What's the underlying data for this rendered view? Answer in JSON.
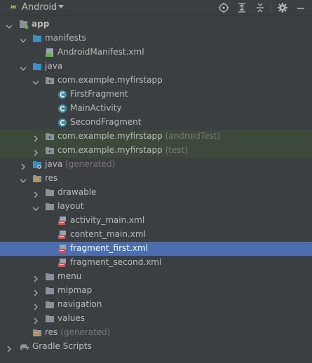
{
  "toolbar": {
    "view_name": "Android",
    "colors": {
      "android_green": "#a4c639",
      "icon_gray": "#afb1b3"
    }
  },
  "tree": {
    "app": "app",
    "manifests": "manifests",
    "android_manifest": "AndroidManifest.xml",
    "java": "java",
    "pkg_main": "com.example.myfirstapp",
    "first_fragment": "FirstFragment",
    "main_activity": "MainActivity",
    "second_fragment": "SecondFragment",
    "pkg_android_test": "com.example.myfirstapp",
    "pkg_android_test_suffix": "(androidTest)",
    "pkg_test": "com.example.myfirstapp",
    "pkg_test_suffix": "(test)",
    "java_generated": "java",
    "java_generated_suffix": "(generated)",
    "res": "res",
    "drawable": "drawable",
    "layout": "layout",
    "activity_main": "activity_main.xml",
    "content_main": "content_main.xml",
    "fragment_first": "fragment_first.xml",
    "fragment_second": "fragment_second.xml",
    "menu": "menu",
    "mipmap": "mipmap",
    "navigation": "navigation",
    "values": "values",
    "res_generated": "res",
    "res_generated_suffix": "(generated)",
    "gradle_scripts": "Gradle Scripts"
  }
}
